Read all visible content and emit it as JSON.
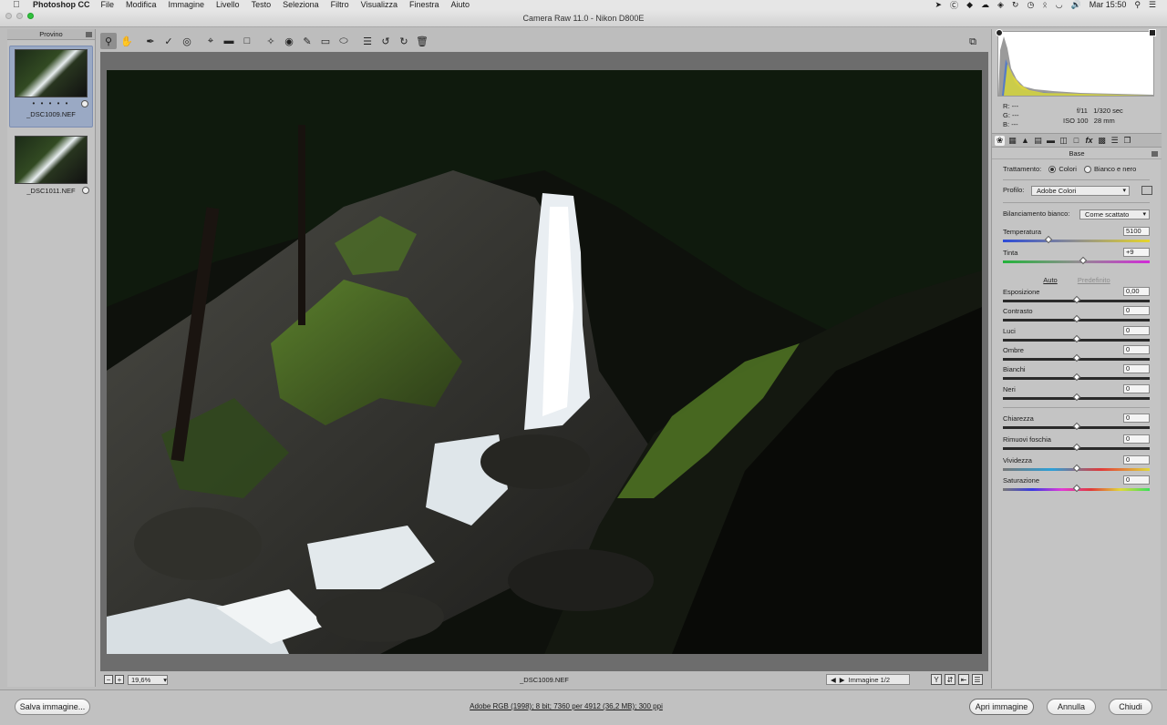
{
  "menubar": {
    "app_name": "Photoshop CC",
    "items": [
      "File",
      "Modifica",
      "Immagine",
      "Livello",
      "Testo",
      "Seleziona",
      "Filtro",
      "Visualizza",
      "Finestra",
      "Aiuto"
    ],
    "clock": "Mar 15:50"
  },
  "window": {
    "title": "Camera Raw 11.0  -  Nikon D800E"
  },
  "filmstrip": {
    "header": "Provino",
    "items": [
      {
        "filename": "_DSC1009.NEF",
        "rating": "• • • • •",
        "selected": true
      },
      {
        "filename": "_DSC1011.NEF",
        "rating": "",
        "selected": false
      }
    ]
  },
  "viewer": {
    "zoom": "19,6%",
    "filename": "_DSC1009.NEF",
    "image_nav": "Immagine 1/2",
    "view_mode_label": "Y"
  },
  "readout": {
    "r_label": "R:",
    "r_value": "---",
    "g_label": "G:",
    "g_value": "---",
    "b_label": "B:",
    "b_value": "---",
    "aperture": "f/11",
    "shutter": "1/320 sec",
    "iso": "ISO 100",
    "focal": "28 mm"
  },
  "panel": {
    "section_title": "Base",
    "treatment_label": "Trattamento:",
    "treatment_color": "Colori",
    "treatment_bw": "Bianco e nero",
    "profile_label": "Profilo:",
    "profile_value": "Adobe Colori",
    "wb_label": "Bilanciamento bianco:",
    "wb_value": "Come scattato",
    "auto_link": "Auto",
    "default_link": "Predefinito",
    "sliders": [
      {
        "label": "Temperatura",
        "value": "5100",
        "level": 0.31
      },
      {
        "label": "Tinta",
        "value": "+9",
        "level": 0.545
      },
      {
        "label": "Esposizione",
        "value": "0,00",
        "level": 0.5
      },
      {
        "label": "Contrasto",
        "value": "0",
        "level": 0.5
      },
      {
        "label": "Luci",
        "value": "0",
        "level": 0.5
      },
      {
        "label": "Ombre",
        "value": "0",
        "level": 0.5
      },
      {
        "label": "Bianchi",
        "value": "0",
        "level": 0.5
      },
      {
        "label": "Neri",
        "value": "0",
        "level": 0.5
      },
      {
        "label": "Chiarezza",
        "value": "0",
        "level": 0.5
      },
      {
        "label": "Rimuovi foschia",
        "value": "0",
        "level": 0.5
      },
      {
        "label": "Vividezza",
        "value": "0",
        "level": 0.5
      },
      {
        "label": "Saturazione",
        "value": "0",
        "level": 0.5
      }
    ]
  },
  "footer": {
    "save_button": "Salva immagine...",
    "workflow_info": "Adobe RGB (1998); 8 bit; 7360 per 4912 (36,2 MB); 300 ppi",
    "open_button": "Apri immagine",
    "cancel_button": "Annulla",
    "close_button": "Chiudi"
  },
  "colors": {
    "accent_selection": "#9aa9c4",
    "panel_bg": "#c4c4c4",
    "canvas_bg": "#6d6d6d"
  }
}
